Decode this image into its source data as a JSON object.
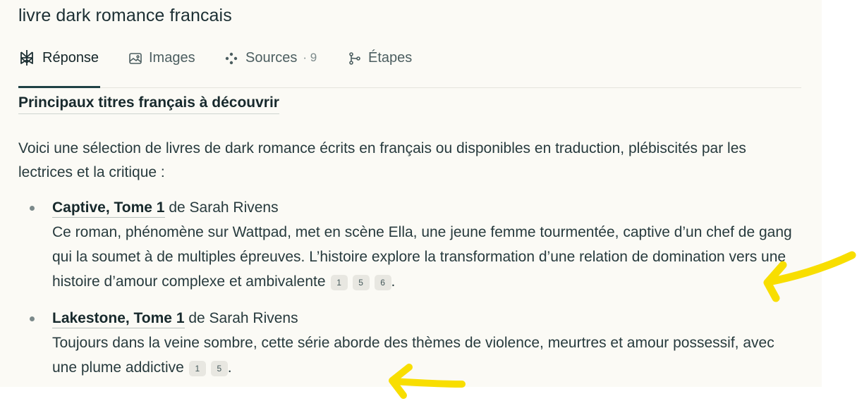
{
  "query": "livre dark romance francais",
  "tabs": [
    {
      "label": "Réponse",
      "icon": "perplexity-logo-icon",
      "active": true
    },
    {
      "label": "Images",
      "icon": "image-icon"
    },
    {
      "label": "Sources",
      "count": "· 9",
      "icon": "sources-icon"
    },
    {
      "label": "Étapes",
      "icon": "steps-icon"
    }
  ],
  "answer": {
    "heading": "Principaux titres français à découvrir",
    "intro": "Voici une sélection de livres de dark romance écrits en français ou disponibles en traduction, plébiscités par les lectrices et la critique :",
    "items": [
      {
        "title": "Captive, Tome 1",
        "author": " de Sarah Rivens",
        "description": "Ce roman, phénomène sur Wattpad, met en scène Ella, une jeune femme tourmentée, captive d’un chef de gang qui la soumet à de multiples épreuves. L’histoire explore la transformation d’une relation de domination vers une histoire d’amour complexe et ambivalente",
        "citations": [
          "1",
          "5",
          "6"
        ],
        "end": "."
      },
      {
        "title": "Lakestone, Tome 1",
        "author": " de Sarah Rivens",
        "description": "Toujours dans la veine sombre, cette série aborde des thèmes de violence, meurtres et amour possessif, avec une plume addictive",
        "citations": [
          "1",
          "5"
        ],
        "end": "."
      }
    ]
  },
  "colors": {
    "panel_bg": "#fbfaf5",
    "annotation_yellow": "#f8de00",
    "text": "#273a3d"
  }
}
